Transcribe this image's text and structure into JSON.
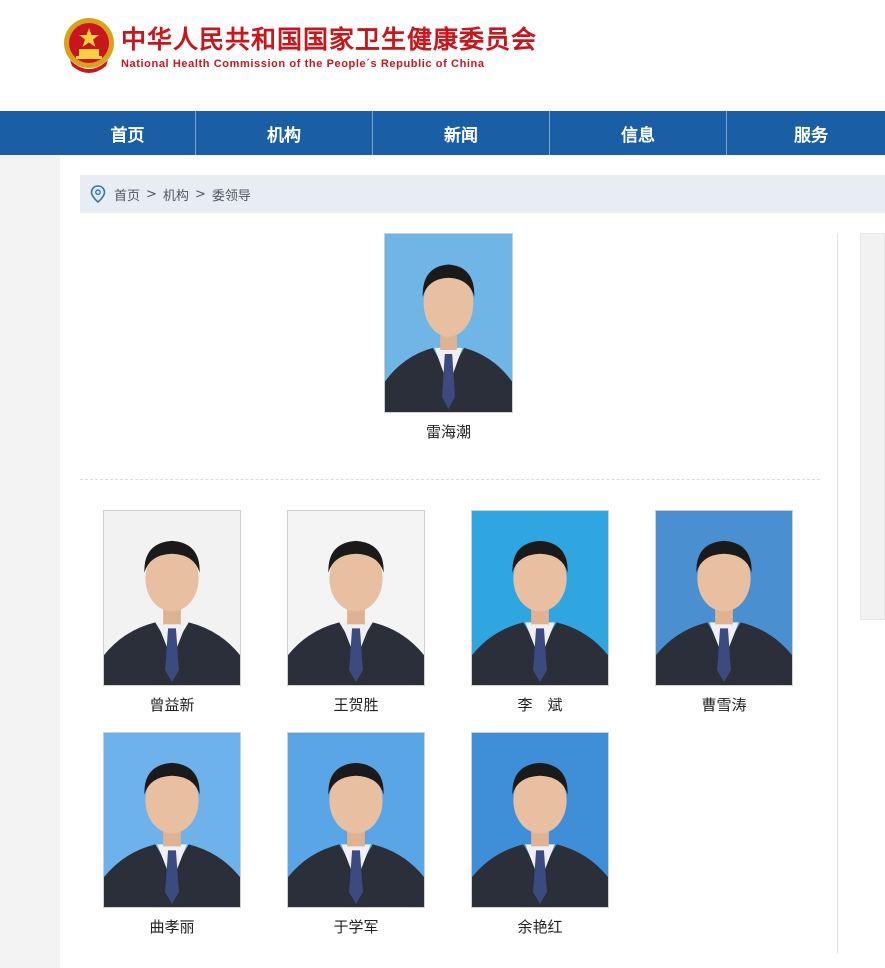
{
  "header": {
    "title_cn": "中华人民共和国国家卫生健康委员会",
    "title_en": "National Health Commission of the People´s Republic of China"
  },
  "nav": {
    "items": [
      "首页",
      "机构",
      "新闻",
      "信息",
      "服务"
    ]
  },
  "breadcrumb": {
    "items": [
      "首页",
      "机构",
      "委领导"
    ],
    "separator": ">"
  },
  "leaders": {
    "top": {
      "name": "雷海潮",
      "bg": "#6fb6e6"
    },
    "others": [
      {
        "name": "曾益新",
        "bg": "#f2f2f2"
      },
      {
        "name": "王贺胜",
        "bg": "#f4f4f4"
      },
      {
        "name": "李　斌",
        "bg": "#2fa6df"
      },
      {
        "name": "曹雪涛",
        "bg": "#4a90d0"
      },
      {
        "name": "曲孝丽",
        "bg": "#6db2ea"
      },
      {
        "name": "于学军",
        "bg": "#5aa5e6"
      },
      {
        "name": "余艳红",
        "bg": "#3f8fd8"
      }
    ]
  },
  "colors": {
    "brand_red": "#c8161d",
    "nav_blue": "#1a5fa6",
    "breadcrumb_bg": "#e8edf4"
  },
  "icons": {
    "emblem": "national-emblem-icon",
    "location": "location-pin-icon"
  }
}
